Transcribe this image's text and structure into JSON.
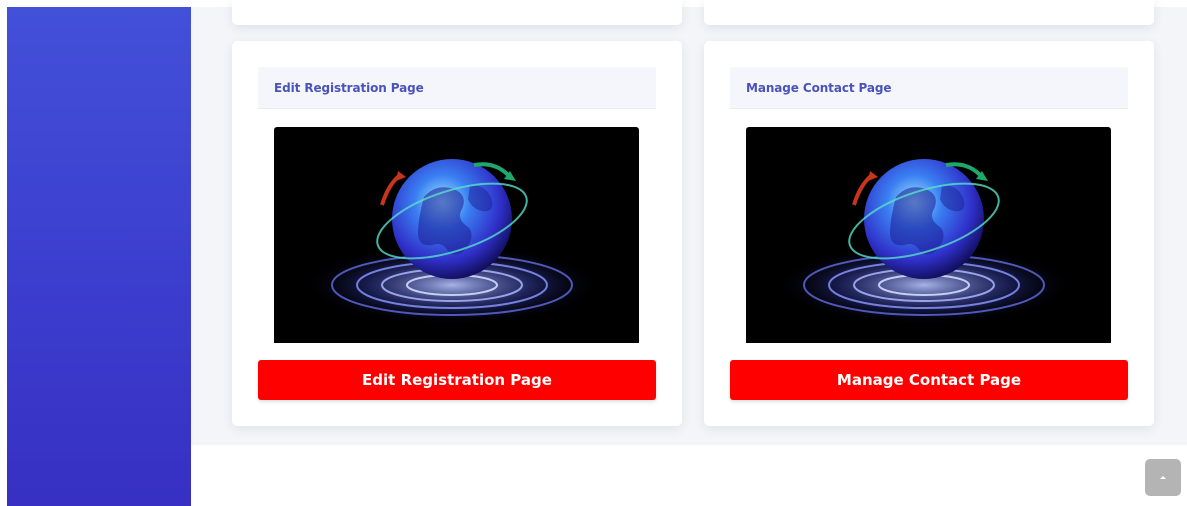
{
  "cards": [
    {
      "header_title": "Edit Registration Page",
      "image": "globe-image",
      "button_label": "Edit Registration Page"
    },
    {
      "header_title": "Manage Contact Page",
      "image": "globe-image",
      "button_label": "Manage Contact Page"
    }
  ],
  "scroll_top_icon": "chevron-up-icon",
  "colors": {
    "sidebar": "#3b3ccd",
    "content_background": "#f3f5f9",
    "header_text": "#4a53b8",
    "button": "#ff0000",
    "scroll_button": "#b4b4b4"
  }
}
